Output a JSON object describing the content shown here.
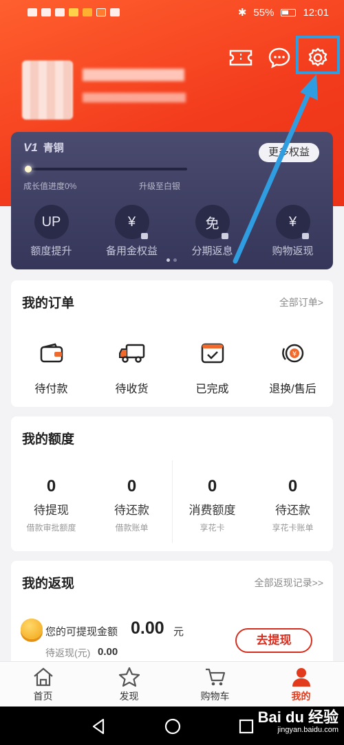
{
  "status_bar": {
    "battery": "55%",
    "time": "12:01"
  },
  "vip": {
    "level": "V1",
    "tier": "青铜",
    "more_benefits": "更多权益",
    "progress_label": "成长值进度0%",
    "upgrade_label": "升级至白银",
    "progress_fraction": 0.0,
    "benefits": [
      {
        "label": "额度提升",
        "glyph": "UP"
      },
      {
        "label": "备用金权益",
        "glyph": "¥"
      },
      {
        "label": "分期返息",
        "glyph": "免"
      },
      {
        "label": "购物返现",
        "glyph": "¥"
      }
    ]
  },
  "orders": {
    "title": "我的订单",
    "link": "全部订单>",
    "items": [
      {
        "label": "待付款",
        "icon": "wallet-icon"
      },
      {
        "label": "待收货",
        "icon": "truck-icon"
      },
      {
        "label": "已完成",
        "icon": "check-box-icon"
      },
      {
        "label": "退换/售后",
        "icon": "refund-icon"
      }
    ]
  },
  "quota": {
    "title": "我的额度",
    "items": [
      {
        "value": "0",
        "label": "待提现",
        "sub": "借款审批额度"
      },
      {
        "value": "0",
        "label": "待还款",
        "sub": "借款账单"
      },
      {
        "value": "0",
        "label": "消费额度",
        "sub": "享花卡"
      },
      {
        "value": "0",
        "label": "待还款",
        "sub": "享花卡账单"
      }
    ]
  },
  "cashback": {
    "title": "我的返现",
    "link": "全部返现记录>>",
    "available_label": "您的可提现金额",
    "available_amount": "0.00",
    "unit": "元",
    "pending_label": "待返现(元)",
    "pending_amount": "0.00",
    "withdraw_button": "去提现"
  },
  "tabs": [
    {
      "label": "首页",
      "icon": "home-icon"
    },
    {
      "label": "发现",
      "icon": "star-icon"
    },
    {
      "label": "购物车",
      "icon": "cart-icon"
    },
    {
      "label": "我的",
      "icon": "person-icon",
      "active": true
    }
  ],
  "watermark": {
    "brand": "Bai du 经验",
    "url": "jingyan.baidu.com"
  },
  "colors": {
    "primary": "#f23a1c",
    "highlight": "#2f9de0",
    "vip_card": "#3f405f"
  }
}
